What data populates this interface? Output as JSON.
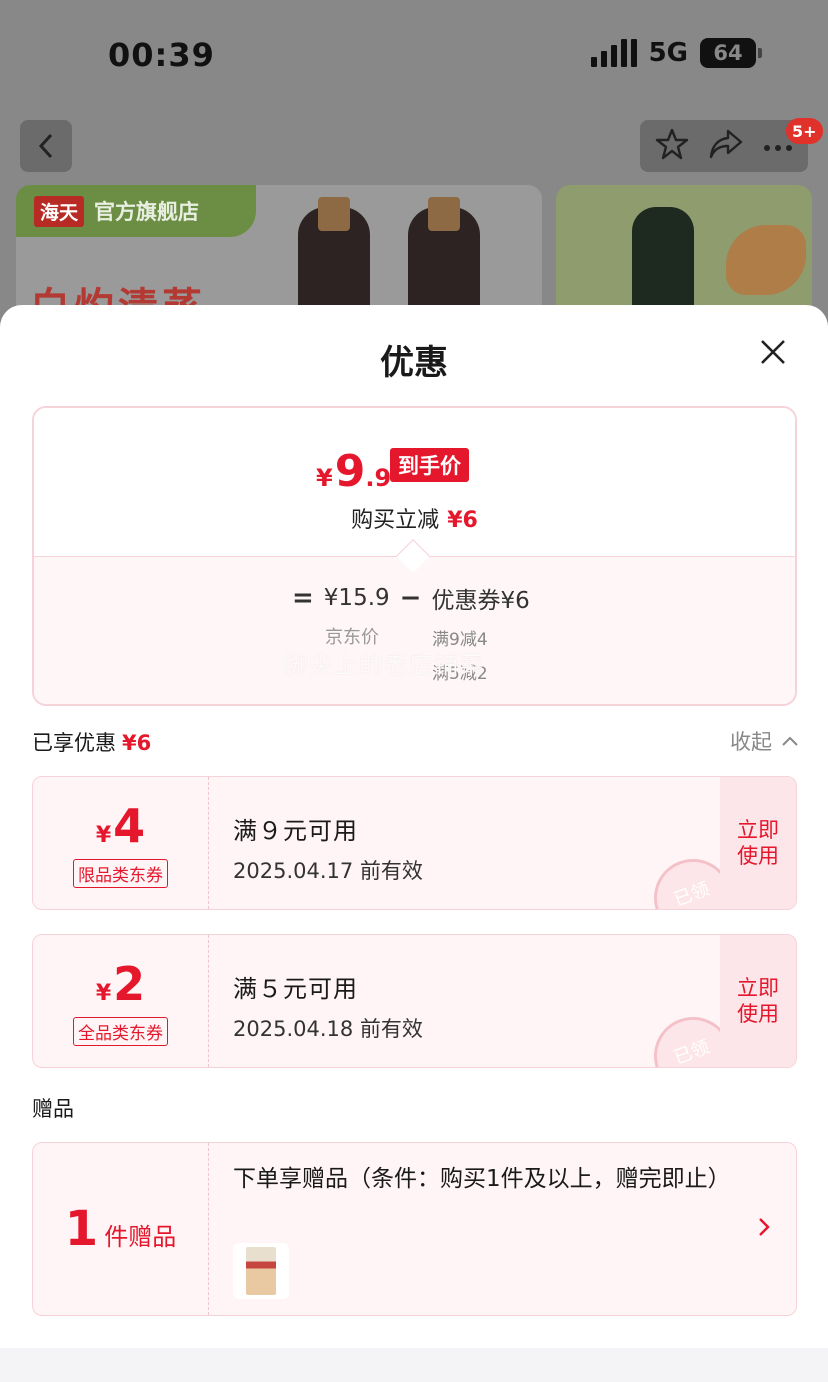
{
  "status_bar": {
    "time": "00:39",
    "network": "5G",
    "battery": "64"
  },
  "nav": {
    "badge": "5+"
  },
  "banner": {
    "brand": "海天",
    "store": "官方旗舰店",
    "slogan": "白灼清蒸"
  },
  "sheet": {
    "title": "优惠"
  },
  "price_card": {
    "currency": "¥",
    "final_int": "9",
    "final_dec": ".9",
    "final_tag": "到手价",
    "reduce_label": "购买立减",
    "reduce_amount": "¥6",
    "equals": "=",
    "jd_price": "¥15.9",
    "minus": "−",
    "coupon_label": "优惠券¥6",
    "jd_price_label": "京东价",
    "coupon_detail_1": "满9减4",
    "coupon_detail_2": "满5减2",
    "watermark": "脚尖上的老店铺菜"
  },
  "enjoyed": {
    "label": "已享优惠",
    "amount": "¥6",
    "collapse": "收起"
  },
  "coupons": [
    {
      "symbol": "¥",
      "amount": "4",
      "type": "限品类东券",
      "condition": "满９元可用",
      "valid": "2025.04.17 前有效",
      "action": "立即\n使用",
      "stamp": "已领"
    },
    {
      "symbol": "¥",
      "amount": "2",
      "type": "全品类东券",
      "condition": "满５元可用",
      "valid": "2025.04.18 前有效",
      "action": "立即\n使用",
      "stamp": "已领"
    }
  ],
  "gift": {
    "section_title": "赠品",
    "count": "1",
    "unit": "件赠品",
    "description": "下单享赠品（条件：购买1件及以上，赠完即止）"
  },
  "colors": {
    "accent": "#e5172c",
    "card_bg": "#fff5f6",
    "card_border": "#f6d3d8"
  }
}
